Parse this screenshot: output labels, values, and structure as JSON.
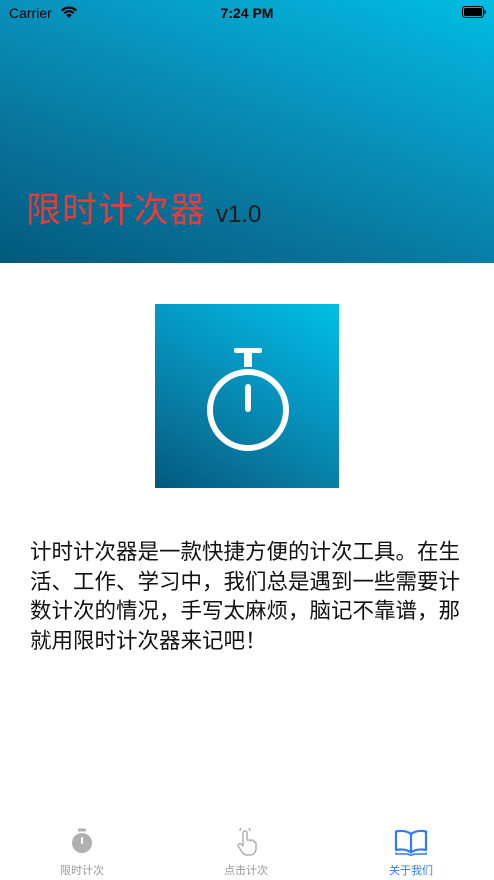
{
  "status_bar": {
    "carrier": "Carrier",
    "time": "7:24 PM",
    "wifi_icon": "wifi-icon",
    "battery_icon": "battery-icon"
  },
  "header": {
    "title": "限时计次器",
    "version": "v1.0",
    "title_color": "#ec3a36"
  },
  "logo": {
    "icon": "stopwatch-icon"
  },
  "description": "计时计次器是一款快捷方便的计次工具。在生活、工作、学习中，我们总是遇到一些需要计数计次的情况，手写太麻烦，脑记不靠谱，那就用限时计次器来记吧！",
  "tabs": [
    {
      "label": "限时计次",
      "icon": "stopwatch-icon",
      "active": false
    },
    {
      "label": "点击计次",
      "icon": "tap-hand-icon",
      "active": false
    },
    {
      "label": "关于我们",
      "icon": "book-icon",
      "active": true
    }
  ],
  "colors": {
    "accent": "#2f7cf6",
    "inactive": "#999999",
    "header_gradient_light": "#01bde0",
    "header_gradient_dark": "#025a7c"
  }
}
